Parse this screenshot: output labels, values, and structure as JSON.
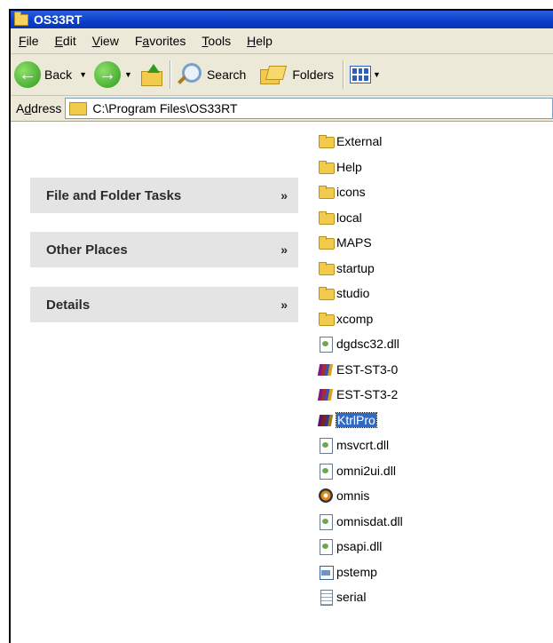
{
  "window": {
    "title": "OS33RT"
  },
  "menu": [
    {
      "pre": "",
      "key": "F",
      "post": "ile"
    },
    {
      "pre": "",
      "key": "E",
      "post": "dit"
    },
    {
      "pre": "",
      "key": "V",
      "post": "iew"
    },
    {
      "pre": "F",
      "key": "a",
      "post": "vorites"
    },
    {
      "pre": "",
      "key": "T",
      "post": "ools"
    },
    {
      "pre": "",
      "key": "H",
      "post": "elp"
    }
  ],
  "toolbar": {
    "back_label": "Back",
    "search_label": "Search",
    "folders_label": "Folders"
  },
  "address": {
    "label_pre": "A",
    "label_key": "d",
    "label_post": "dress",
    "value": "C:\\Program Files\\OS33RT"
  },
  "tasks": [
    {
      "label": "File and Folder Tasks"
    },
    {
      "label": "Other Places"
    },
    {
      "label": "Details"
    }
  ],
  "chevron": "»",
  "files": [
    {
      "name": "External",
      "icon": "folder-icon"
    },
    {
      "name": "Help",
      "icon": "folder-icon"
    },
    {
      "name": "icons",
      "icon": "folder-icon"
    },
    {
      "name": "local",
      "icon": "folder-icon"
    },
    {
      "name": "MAPS",
      "icon": "folder-icon"
    },
    {
      "name": "startup",
      "icon": "folder-icon"
    },
    {
      "name": "studio",
      "icon": "folder-icon"
    },
    {
      "name": "xcomp",
      "icon": "folder-icon"
    },
    {
      "name": "dgdsc32.dll",
      "icon": "dll-icon"
    },
    {
      "name": "EST-ST3-0",
      "icon": "books-icon"
    },
    {
      "name": "EST-ST3-2",
      "icon": "books-icon"
    },
    {
      "name": "KtrlPro",
      "icon": "books-icon",
      "selected": true
    },
    {
      "name": "msvcrt.dll",
      "icon": "dll-icon"
    },
    {
      "name": "omni2ui.dll",
      "icon": "dll-icon"
    },
    {
      "name": "omnis",
      "icon": "omnis-app-icon"
    },
    {
      "name": "omnisdat.dll",
      "icon": "dll-icon"
    },
    {
      "name": "psapi.dll",
      "icon": "dll-icon"
    },
    {
      "name": "pstemp",
      "icon": "application-icon"
    },
    {
      "name": "serial",
      "icon": "text-file-icon"
    }
  ]
}
